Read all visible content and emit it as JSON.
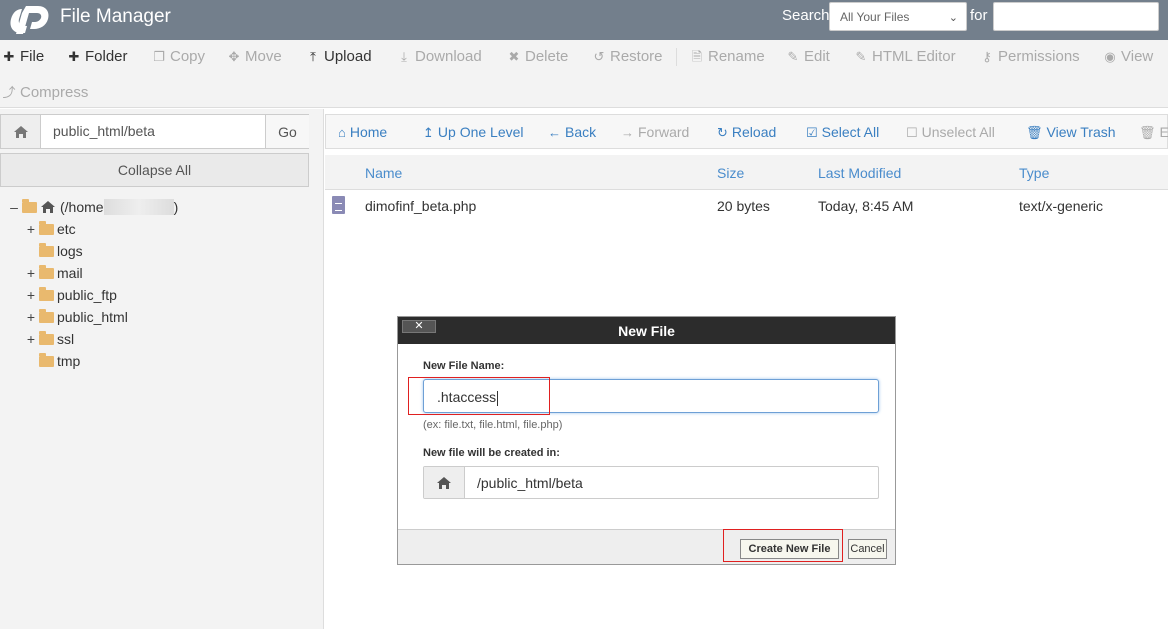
{
  "header": {
    "title": "File Manager",
    "search_label": "Search",
    "search_scope": "All Your Files",
    "for_label": "for",
    "search_value": ""
  },
  "toolbar": {
    "items": [
      {
        "label": "File",
        "icon": "plus-icon",
        "enabled": true
      },
      {
        "label": "Folder",
        "icon": "plus-icon",
        "enabled": true
      },
      {
        "label": "Copy",
        "icon": "copy-icon",
        "enabled": false
      },
      {
        "label": "Move",
        "icon": "move-icon",
        "enabled": false
      },
      {
        "label": "Upload",
        "icon": "upload-icon",
        "enabled": true
      },
      {
        "label": "Download",
        "icon": "download-icon",
        "enabled": false
      },
      {
        "label": "Delete",
        "icon": "x-icon",
        "enabled": false
      },
      {
        "label": "Restore",
        "icon": "restore-icon",
        "enabled": false
      },
      {
        "label": "Rename",
        "icon": "file-icon",
        "enabled": false
      },
      {
        "label": "Edit",
        "icon": "pencil-icon",
        "enabled": false
      },
      {
        "label": "HTML Editor",
        "icon": "edit-box-icon",
        "enabled": false
      },
      {
        "label": "Permissions",
        "icon": "key-icon",
        "enabled": false
      },
      {
        "label": "View",
        "icon": "eye-icon",
        "enabled": false
      },
      {
        "label": "Compress",
        "icon": "compress-icon",
        "enabled": false
      }
    ]
  },
  "left": {
    "path_value": "public_html/beta",
    "go_label": "Go",
    "collapse_label": "Collapse All",
    "root_label_prefix": "(/home",
    "root_label_suffix": ")",
    "tree": [
      {
        "label": "etc",
        "expandable": true
      },
      {
        "label": "logs",
        "expandable": false
      },
      {
        "label": "mail",
        "expandable": true
      },
      {
        "label": "public_ftp",
        "expandable": true
      },
      {
        "label": "public_html",
        "expandable": true
      },
      {
        "label": "ssl",
        "expandable": true
      },
      {
        "label": "tmp",
        "expandable": false
      }
    ]
  },
  "nav": {
    "items": [
      {
        "label": "Home",
        "icon": "home-icon",
        "enabled": true
      },
      {
        "label": "Up One Level",
        "icon": "level-up-icon",
        "enabled": true
      },
      {
        "label": "Back",
        "icon": "arrow-left-icon",
        "enabled": true
      },
      {
        "label": "Forward",
        "icon": "arrow-right-icon",
        "enabled": false
      },
      {
        "label": "Reload",
        "icon": "reload-icon",
        "enabled": true
      },
      {
        "label": "Select All",
        "icon": "checkbox-checked-icon",
        "enabled": true
      },
      {
        "label": "Unselect All",
        "icon": "checkbox-empty-icon",
        "enabled": false
      },
      {
        "label": "View Trash",
        "icon": "trash-icon",
        "enabled": true
      },
      {
        "label": "Em",
        "icon": "trash-icon",
        "enabled": false
      }
    ]
  },
  "list": {
    "columns": [
      "Name",
      "Size",
      "Last Modified",
      "Type"
    ],
    "rows": [
      {
        "name": "dimofinf_beta.php",
        "size": "20 bytes",
        "modified": "Today, 8:45 AM",
        "type": "text/x-generic"
      }
    ]
  },
  "modal": {
    "title": "New File",
    "close_label": "✕",
    "name_label": "New File Name:",
    "name_value": ".htaccess",
    "hint": "(ex: file.txt, file.html, file.php)",
    "location_label": "New file will be created in:",
    "location_value": "/public_html/beta",
    "create_label": "Create New File",
    "cancel_label": "Cancel"
  },
  "colors": {
    "header_bg": "#737f8c",
    "link": "#3a7fc1",
    "highlight": "#e02020",
    "folder": "#e9b96e"
  }
}
